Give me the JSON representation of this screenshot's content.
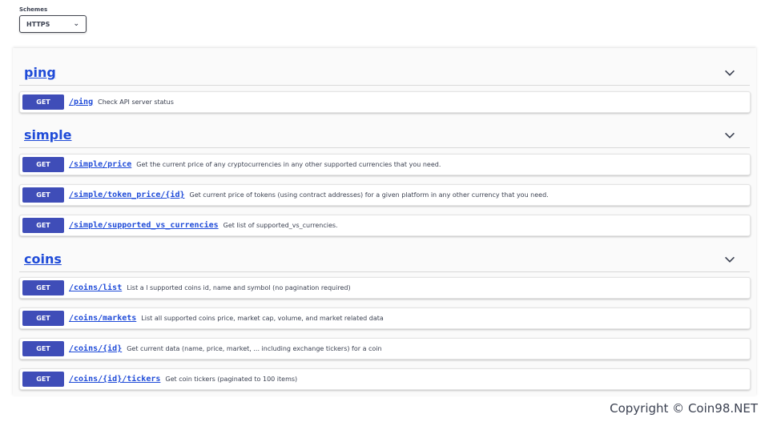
{
  "schemes": {
    "label": "Schemes",
    "selected": "HTTPS"
  },
  "sections": [
    {
      "name": "ping",
      "operations": [
        {
          "method": "GET",
          "path": "/ping",
          "description": "Check API server status"
        }
      ]
    },
    {
      "name": "simple",
      "operations": [
        {
          "method": "GET",
          "path": "/simple/price",
          "description": "Get the current price of any cryptocurrencies in any other supported currencies that you need."
        },
        {
          "method": "GET",
          "path": "/simple/token_price/{id}",
          "description": "Get current price of tokens (using contract addresses) for a given platform in any other currency that you need."
        },
        {
          "method": "GET",
          "path": "/simple/supported_vs_currencies",
          "description": "Get list of supported_vs_currencies."
        }
      ]
    },
    {
      "name": "coins",
      "operations": [
        {
          "method": "GET",
          "path": "/coins/list",
          "description": "List a l supported coins id, name and symbol (no pagination required)"
        },
        {
          "method": "GET",
          "path": "/coins/markets",
          "description": "List all supported coins price, market cap, volume, and market related data"
        },
        {
          "method": "GET",
          "path": "/coins/{id}",
          "description": "Get current data (name, price, market, ... including exchange tickers) for a coin"
        },
        {
          "method": "GET",
          "path": "/coins/{id}/tickers",
          "description": "Get coin tickers (paginated to 100 items)"
        }
      ]
    }
  ],
  "watermark": "Copyright © Coin98.NET",
  "colors": {
    "method_get": "#3f4db8",
    "link": "#1f4bd8"
  }
}
